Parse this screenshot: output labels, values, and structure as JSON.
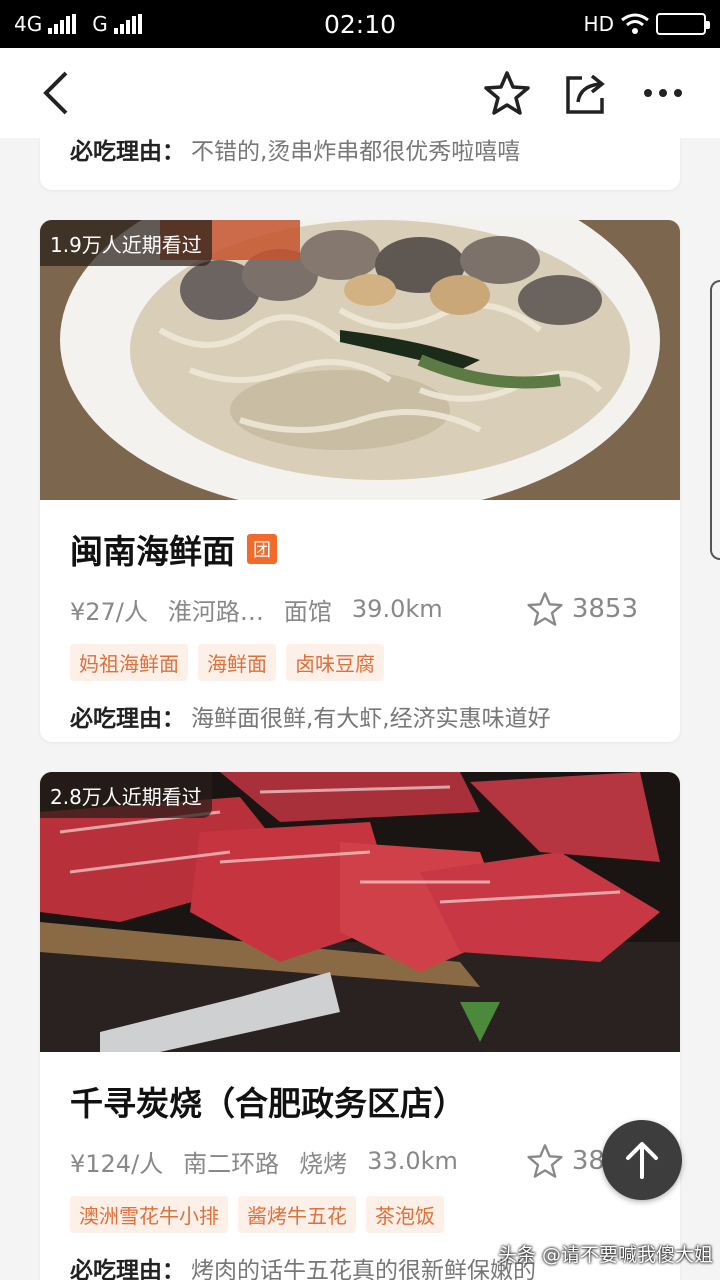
{
  "status_bar": {
    "network1": "4G",
    "network2": "G",
    "time": "02:10",
    "hd": "HD"
  },
  "header": {
    "back_icon": "chevron-left-icon",
    "star_icon": "star-outline-icon",
    "share_icon": "share-icon",
    "more_icon": "more-horizontal-icon"
  },
  "prev_card": {
    "reason_label": "必吃理由：",
    "reason_text": "不错的,烫串炸串都很优秀啦嘻嘻"
  },
  "cards": [
    {
      "views": "1.9万人近期看过",
      "title": "闽南海鲜面",
      "tuan": "团",
      "price": "¥27/人",
      "area": "淮河路…",
      "category": "面馆",
      "distance": "39.0km",
      "favorites": "3853",
      "tags": [
        "妈祖海鲜面",
        "海鲜面",
        "卤味豆腐"
      ],
      "reason_label": "必吃理由：",
      "reason_text": "海鲜面很鲜,有大虾,经济实惠味道好"
    },
    {
      "views": "2.8万人近期看过",
      "title": "千寻炭烧（合肥政务区店）",
      "price": "¥124/人",
      "area": "南二环路",
      "category": "烧烤",
      "distance": "33.0km",
      "favorites": "3869",
      "tags": [
        "澳洲雪花牛小排",
        "酱烤牛五花",
        "茶泡饭"
      ],
      "reason_label": "必吃理由：",
      "reason_text": "烤肉的话牛五花真的很新鲜保嫩的"
    }
  ],
  "watermark": "头条 @请不要喊我傻大姐",
  "colors": {
    "accent": "#f26b2b",
    "tag_text": "#e0703a",
    "tag_bg": "#fdf0e8"
  }
}
